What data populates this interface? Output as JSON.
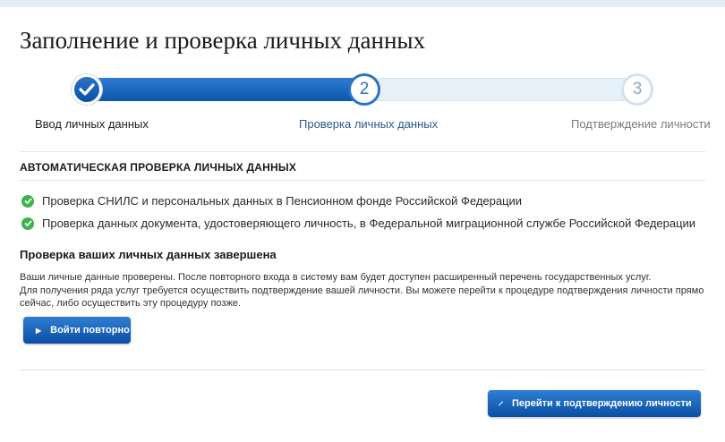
{
  "page": {
    "title": "Заполнение и проверка личных данных"
  },
  "stepper": {
    "progress": 0.5,
    "steps": [
      {
        "number": "1",
        "label": "Ввод личных данных",
        "state": "done"
      },
      {
        "number": "2",
        "label": "Проверка личных данных",
        "state": "active"
      },
      {
        "number": "3",
        "label": "Подтверждение личности",
        "state": "pending"
      }
    ]
  },
  "section": {
    "title": "АВТОМАТИЧЕСКАЯ ПРОВЕРКА ЛИЧНЫХ ДАННЫХ",
    "checks": [
      {
        "text": "Проверка СНИЛС и персональных данных в Пенсионном фонде Российской Федерации",
        "status": "ok"
      },
      {
        "text": "Проверка данных документа, удостоверяющего личность, в Федеральной миграционной службе Российской Федерации",
        "status": "ok"
      }
    ]
  },
  "result": {
    "title": "Проверка ваших личных данных завершена",
    "line1": "Ваши личные данные проверены. После повторного входа в систему вам будет доступен расширенный перечень государственных услуг.",
    "line2": "Для получения ряда услуг требуется осуществить подтверждение вашей личности. Вы можете перейти к процедуре подтверждения личности прямо сейчас, либо осуществить эту процедуру позже."
  },
  "buttons": {
    "relogin": "Войти повторно",
    "confirm": "Перейти к подтверждению личности"
  },
  "colors": {
    "accent": "#0b55ab",
    "success": "#3fb24b",
    "track": "#e6f0f8"
  },
  "icons": {
    "step_done": "checkmark-icon",
    "check_ok": "check-circle-icon",
    "relogin_arrow": "triangle-right-icon",
    "confirm_arrow": "chevron-right-icon"
  }
}
